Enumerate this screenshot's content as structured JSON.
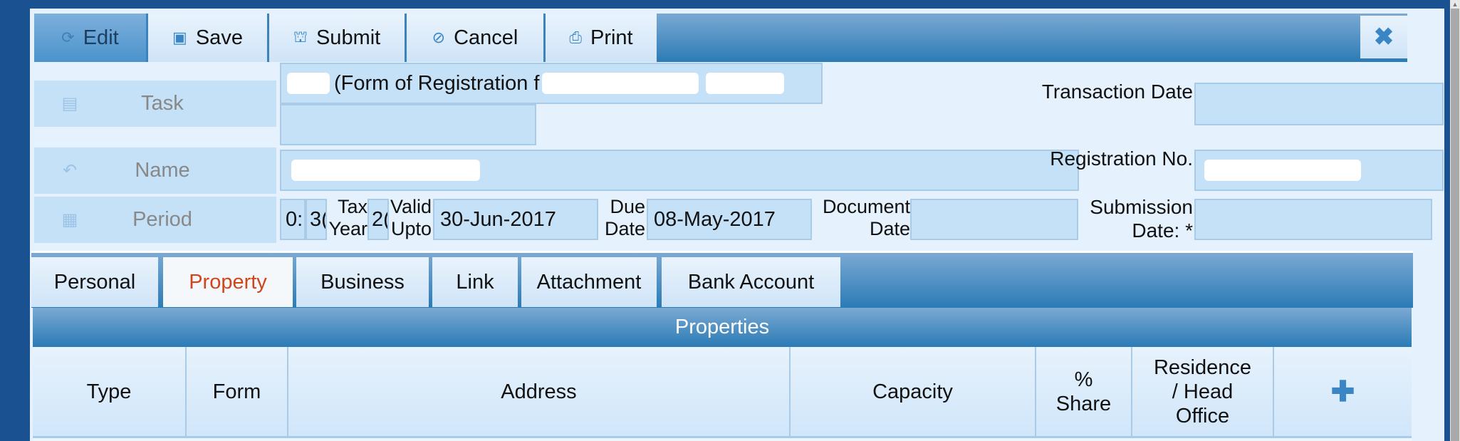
{
  "toolbar": {
    "buttons": [
      {
        "label": "Edit",
        "icon": "refresh-icon",
        "state": "active"
      },
      {
        "label": "Save",
        "icon": "floppy-disk-icon"
      },
      {
        "label": "Submit",
        "icon": "briefcase-icon"
      },
      {
        "label": "Cancel",
        "icon": "ban-icon"
      },
      {
        "label": "Print",
        "icon": "printer-icon"
      }
    ],
    "close_icon": "close-icon"
  },
  "form": {
    "task": {
      "label": "Task",
      "icon": "notebook-icon",
      "value": "(Form of Registration f",
      "value_redacted": true
    },
    "name": {
      "label": "Name",
      "icon": "reply-icon",
      "value_redacted": true
    },
    "period": {
      "label": "Period",
      "icon": "calendar-icon",
      "from": "0:",
      "to": "3(",
      "tax_year_label": "Tax Year",
      "tax_year": "2(",
      "valid_upto_label": "Valid Upto",
      "valid_upto": "30-Jun-2017",
      "due_date_label": "Due Date",
      "due_date": "08-May-2017",
      "document_date_label": "Document Date",
      "document_date": ""
    },
    "transaction_date": {
      "label": "Transaction Date",
      "value": ""
    },
    "registration_no": {
      "label": "Registration No.",
      "value_redacted": true
    },
    "submission_date": {
      "label": "Submission Date: *",
      "value": ""
    }
  },
  "tabs": [
    {
      "label": "Personal"
    },
    {
      "label": "Property",
      "active": true
    },
    {
      "label": "Business"
    },
    {
      "label": "Link"
    },
    {
      "label": "Attachment"
    },
    {
      "label": "Bank Account"
    }
  ],
  "properties": {
    "title": "Properties",
    "columns": [
      "Type",
      "Form",
      "Address",
      "Capacity",
      "% Share",
      "Residence / Head Office"
    ],
    "add_icon": "plus-icon",
    "rows": []
  },
  "colors": {
    "accent": "#2b7bb6",
    "active_tab_text": "#d0461a",
    "frame": "#1a5291",
    "field_bg": "#c5e1f7"
  }
}
